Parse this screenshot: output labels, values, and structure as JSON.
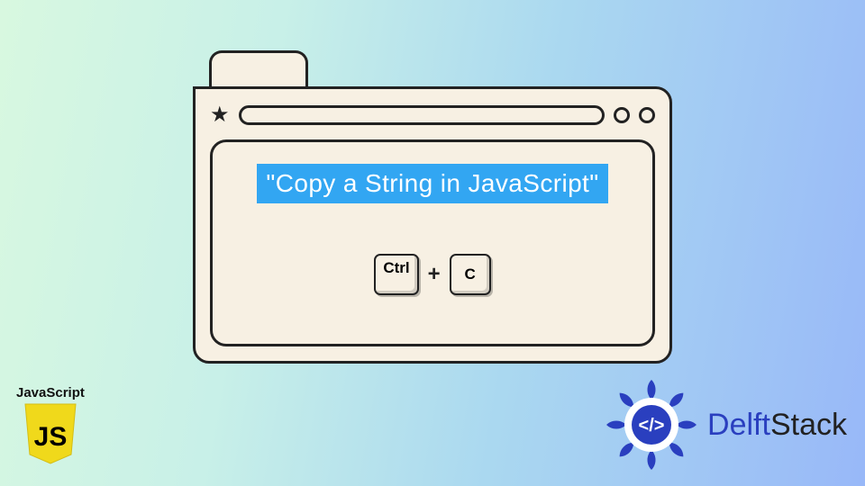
{
  "window": {
    "highlighted_text": "\"Copy a String in JavaScript\"",
    "key1": "Ctrl",
    "plus": "+",
    "key2": "C"
  },
  "js_badge": {
    "label": "JavaScript",
    "letters": "JS"
  },
  "delftstack": {
    "text_delft": "Delft",
    "text_stack": "Stack",
    "brand_color": "#2a3fbf"
  },
  "colors": {
    "highlight_bg": "#32a6f2",
    "window_bg": "#f7f0e3",
    "stroke": "#222222"
  }
}
